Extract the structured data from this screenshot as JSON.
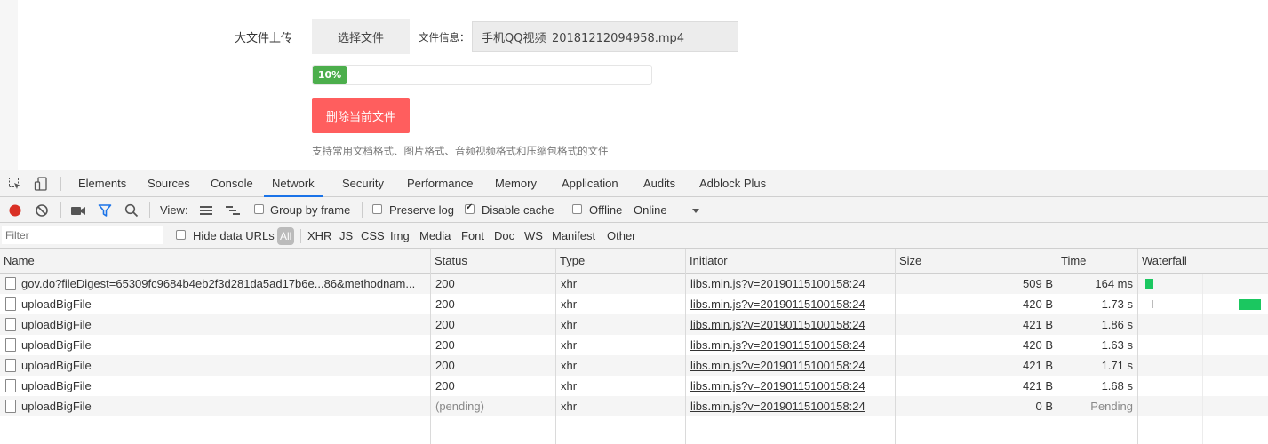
{
  "page": {
    "upload_label": "大文件上传",
    "choose_button": "选择文件",
    "file_info_label": "文件信息：",
    "file_name": "手机QQ视频_20181212094958.mp4",
    "progress_text": "10%",
    "progress_value": 0.1,
    "delete_button": "删除当前文件",
    "hint": "支持常用文档格式、图片格式、音频视频格式和压缩包格式的文件"
  },
  "devtools": {
    "tabs": [
      "Elements",
      "Sources",
      "Console",
      "Network",
      "Security",
      "Performance",
      "Memory",
      "Application",
      "Audits",
      "Adblock Plus"
    ],
    "active_tab": "Network",
    "toolbar": {
      "view_label": "View:",
      "group_by_frame": "Group by frame",
      "preserve_log": "Preserve log",
      "disable_cache": "Disable cache",
      "offline": "Offline",
      "throttle": "Online"
    },
    "filter": {
      "placeholder": "Filter",
      "hide_data_urls": "Hide data URLs",
      "types": [
        "All",
        "XHR",
        "JS",
        "CSS",
        "Img",
        "Media",
        "Font",
        "Doc",
        "WS",
        "Manifest",
        "Other"
      ]
    },
    "columns": [
      "Name",
      "Status",
      "Type",
      "Initiator",
      "Size",
      "Time",
      "Waterfall"
    ],
    "rows": [
      {
        "name": "gov.do?fileDigest=65309fc9684b4eb2f3d281da5ad17b6e...86&methodnam...",
        "status": "200",
        "type": "xhr",
        "initiator": "libs.min.js?v=20190115100158:24",
        "size": "509 B",
        "time": "164 ms"
      },
      {
        "name": "uploadBigFile",
        "status": "200",
        "type": "xhr",
        "initiator": "libs.min.js?v=20190115100158:24",
        "size": "420 B",
        "time": "1.73 s"
      },
      {
        "name": "uploadBigFile",
        "status": "200",
        "type": "xhr",
        "initiator": "libs.min.js?v=20190115100158:24",
        "size": "421 B",
        "time": "1.86 s"
      },
      {
        "name": "uploadBigFile",
        "status": "200",
        "type": "xhr",
        "initiator": "libs.min.js?v=20190115100158:24",
        "size": "420 B",
        "time": "1.63 s"
      },
      {
        "name": "uploadBigFile",
        "status": "200",
        "type": "xhr",
        "initiator": "libs.min.js?v=20190115100158:24",
        "size": "421 B",
        "time": "1.71 s"
      },
      {
        "name": "uploadBigFile",
        "status": "200",
        "type": "xhr",
        "initiator": "libs.min.js?v=20190115100158:24",
        "size": "421 B",
        "time": "1.68 s"
      },
      {
        "name": "uploadBigFile",
        "status": "(pending)",
        "type": "xhr",
        "initiator": "libs.min.js?v=20190115100158:24",
        "size": "0 B",
        "time": "Pending"
      }
    ],
    "colors": {
      "accent": "#1a73e8",
      "waterfall": "#1bc760",
      "progress": "#4cae4c",
      "delete": "#ff5e5e",
      "record": "#d93025"
    }
  }
}
